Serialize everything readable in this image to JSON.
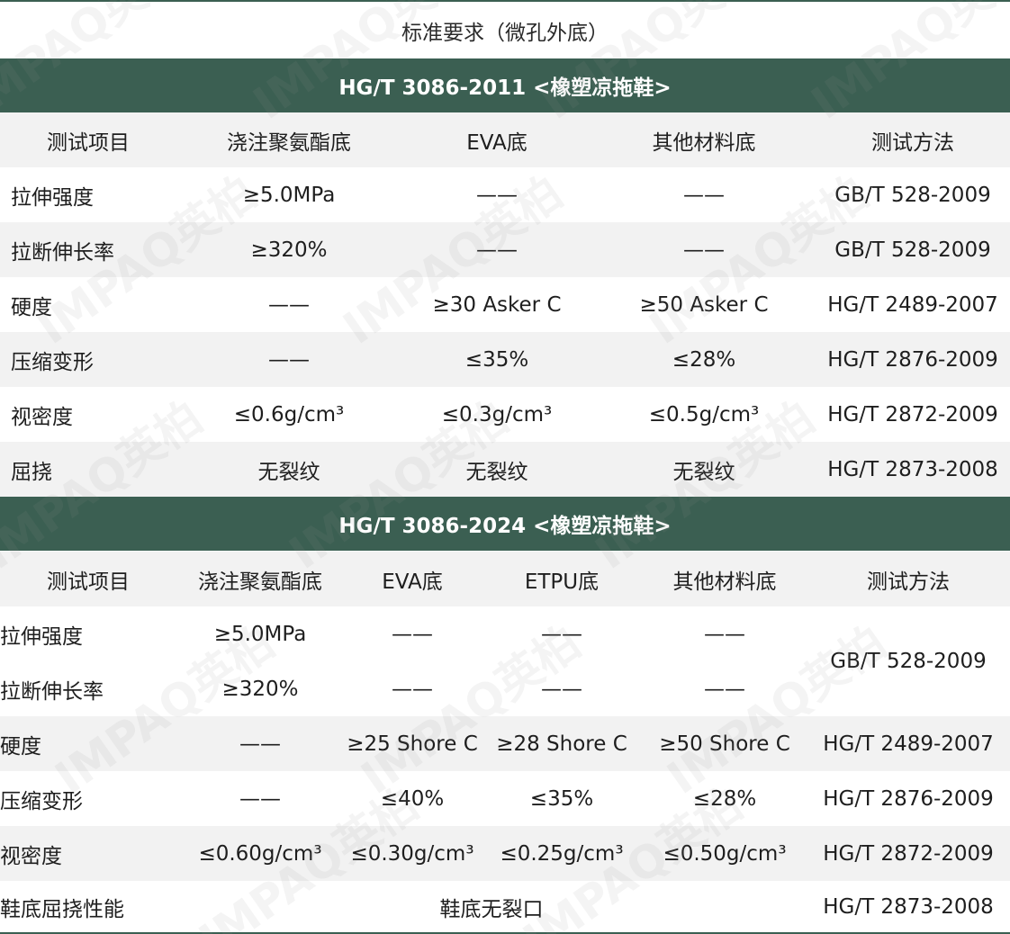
{
  "title": "标准要求（微孔外底）",
  "table2011": {
    "band": "HG/T 3086-2011 <橡塑凉拖鞋>",
    "headers": [
      "测试项目",
      "浇注聚氨酯底",
      "EVA底",
      "其他材料底",
      "测试方法"
    ],
    "rows": [
      [
        "拉伸强度",
        "≥5.0MPa",
        "——",
        "——",
        "GB/T 528-2009"
      ],
      [
        "拉断伸长率",
        "≥320%",
        "——",
        "——",
        "GB/T 528-2009"
      ],
      [
        "硬度",
        "——",
        "≥30 Asker C",
        "≥50 Asker C",
        "HG/T 2489-2007"
      ],
      [
        "压缩变形",
        "——",
        "≤35%",
        "≤28%",
        "HG/T 2876-2009"
      ],
      [
        "视密度",
        "≤0.6g/cm³",
        "≤0.3g/cm³",
        "≤0.5g/cm³",
        "HG/T 2872-2009"
      ],
      [
        "屈挠",
        "无裂纹",
        "无裂纹",
        "无裂纹",
        "HG/T 2873-2008"
      ]
    ]
  },
  "table2024": {
    "band": "HG/T 3086-2024 <橡塑凉拖鞋>",
    "headers": [
      "测试项目",
      "浇注聚氨酯底",
      "EVA底",
      "ETPU底",
      "其他材料底",
      "测试方法"
    ],
    "rows": [
      [
        "拉伸强度",
        "≥5.0MPa",
        "——",
        "——",
        "——"
      ],
      [
        "拉断伸长率",
        "≥320%",
        "——",
        "——",
        "——"
      ],
      [
        "硬度",
        "——",
        "≥25 Shore C",
        "≥28 Shore C",
        "≥50 Shore C",
        "HG/T 2489-2007"
      ],
      [
        "压缩变形",
        "——",
        "≤40%",
        "≤35%",
        "≤28%",
        "HG/T 2876-2009"
      ],
      [
        "视密度",
        "≤0.60g/cm³",
        "≤0.30g/cm³",
        "≤0.25g/cm³",
        "≤0.50g/cm³",
        "HG/T 2872-2009"
      ],
      [
        "鞋底屈挠性能",
        "鞋底无裂口",
        "HG/T 2873-2008"
      ]
    ],
    "merged_method": "GB/T 528-2009"
  },
  "watermark": "IMPAQ英柏",
  "colors": {
    "band": "#3b5f52",
    "stripe": "#f2f2f2"
  }
}
